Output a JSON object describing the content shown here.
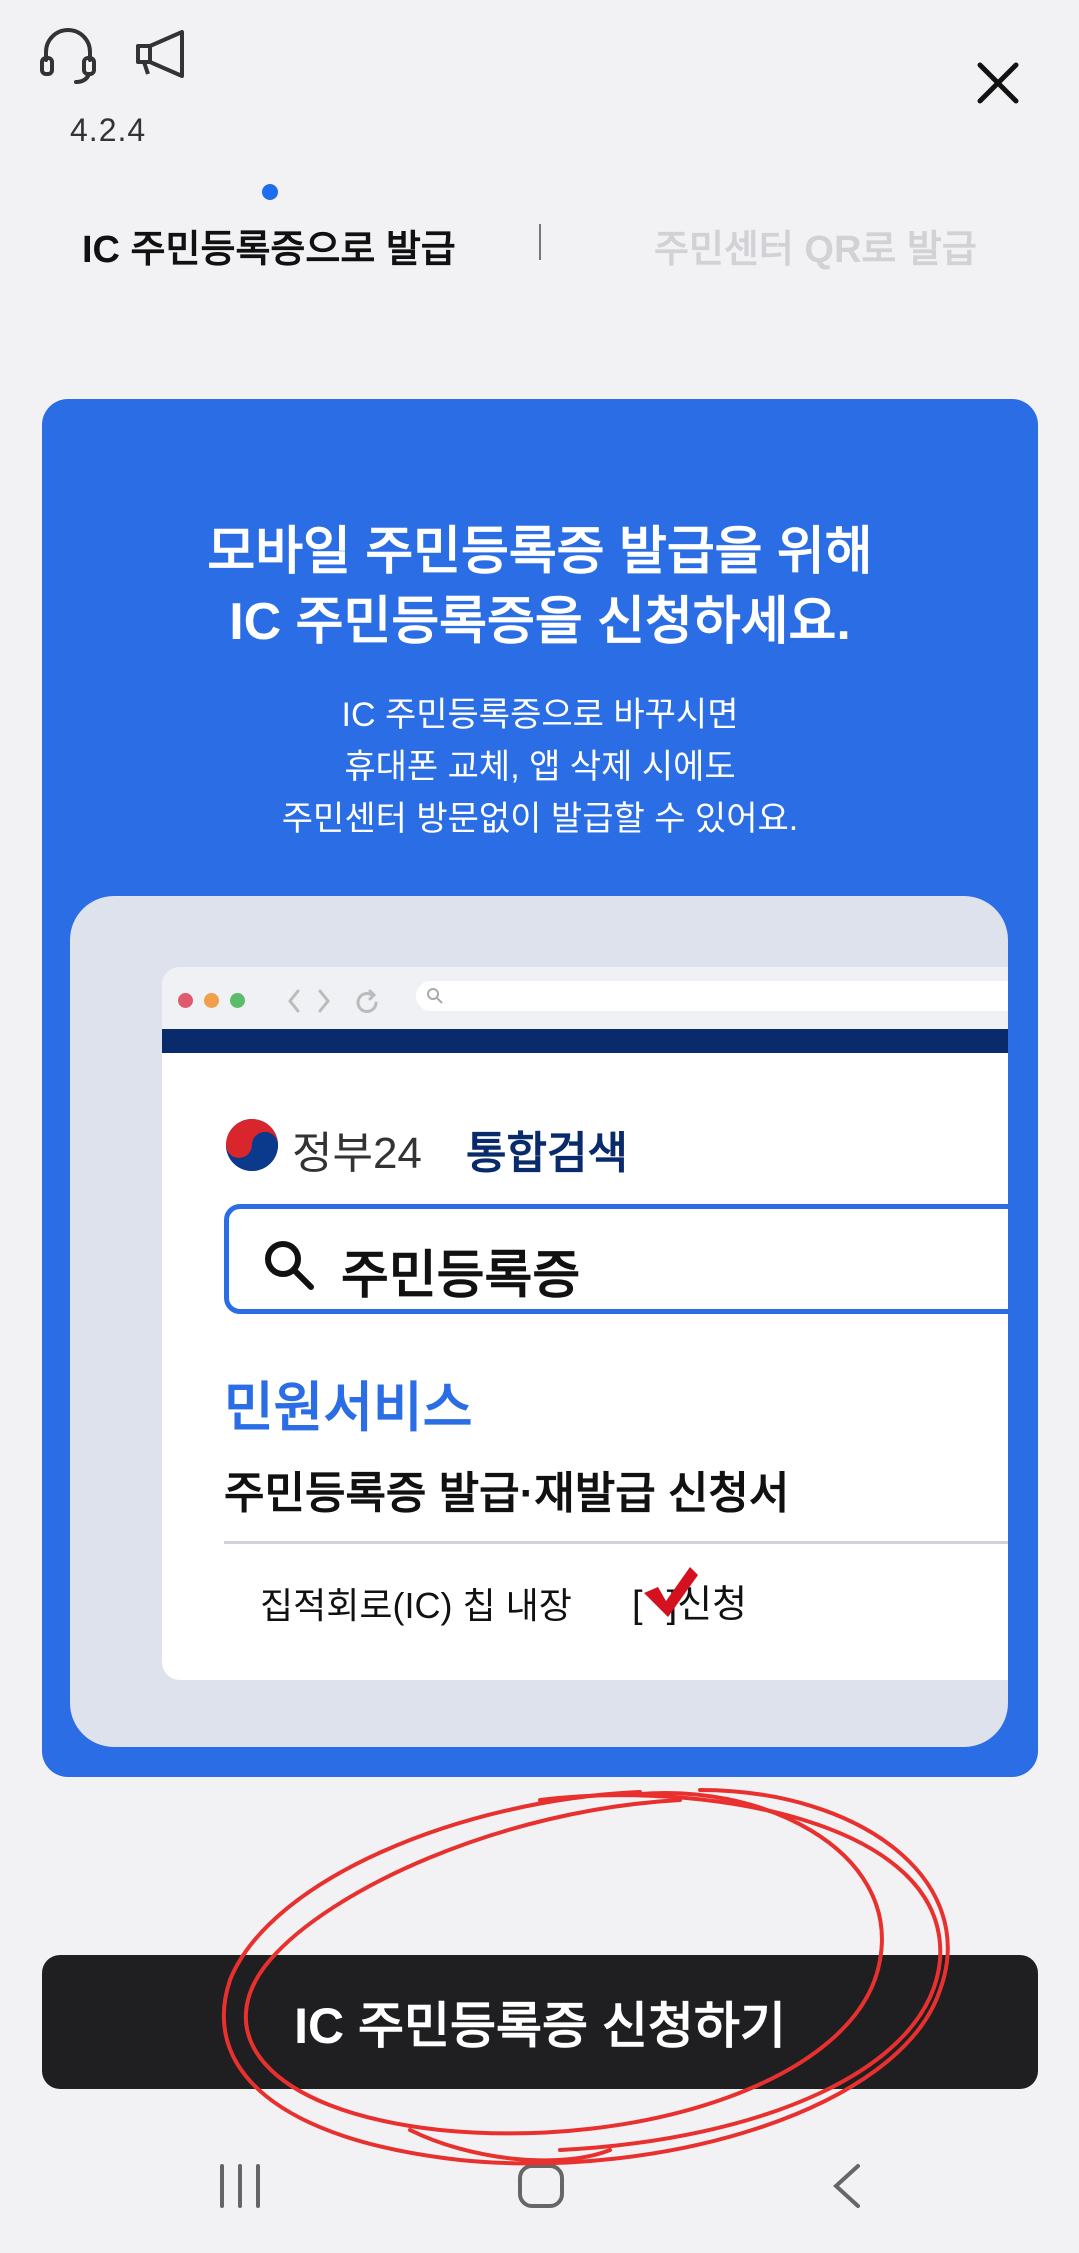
{
  "header": {
    "version": "4.2.4",
    "support_icon": "headset-icon",
    "notice_icon": "megaphone-icon",
    "close_icon": "close-icon"
  },
  "tabs": [
    {
      "label": "IC 주민등록증으로 발급",
      "active": true
    },
    {
      "label": "주민센터 QR로 발급",
      "active": false
    }
  ],
  "card": {
    "headline_line1": "모바일 주민등록증 발급을 위해",
    "headline_line2": "IC 주민등록증을 신청하세요.",
    "desc_line1": "IC 주민등록증으로 바꾸시면",
    "desc_line2": "휴대폰 교체, 앱 삭제 시에도",
    "desc_line3": "주민센터 방문없이 발급할 수 있어요.",
    "illustration": {
      "gov_name": "정부24",
      "search_tag": "통합검색",
      "search_query": "주민등록증",
      "service_title": "민원서비스",
      "service_item": "주민등록증 발급·재발급 신청서",
      "option_label": "집적회로(IC) 칩 내장",
      "option_check_open": "[",
      "option_check_close": "]신청"
    }
  },
  "cta": {
    "label": "IC 주민등록증 신청하기"
  },
  "colors": {
    "accent_blue": "#2a6de5",
    "navy": "#0a2b6b",
    "annotation_red": "#e8312f",
    "check_red": "#d4121f"
  },
  "navbar": [
    "recent-apps-icon",
    "home-icon",
    "back-icon"
  ]
}
